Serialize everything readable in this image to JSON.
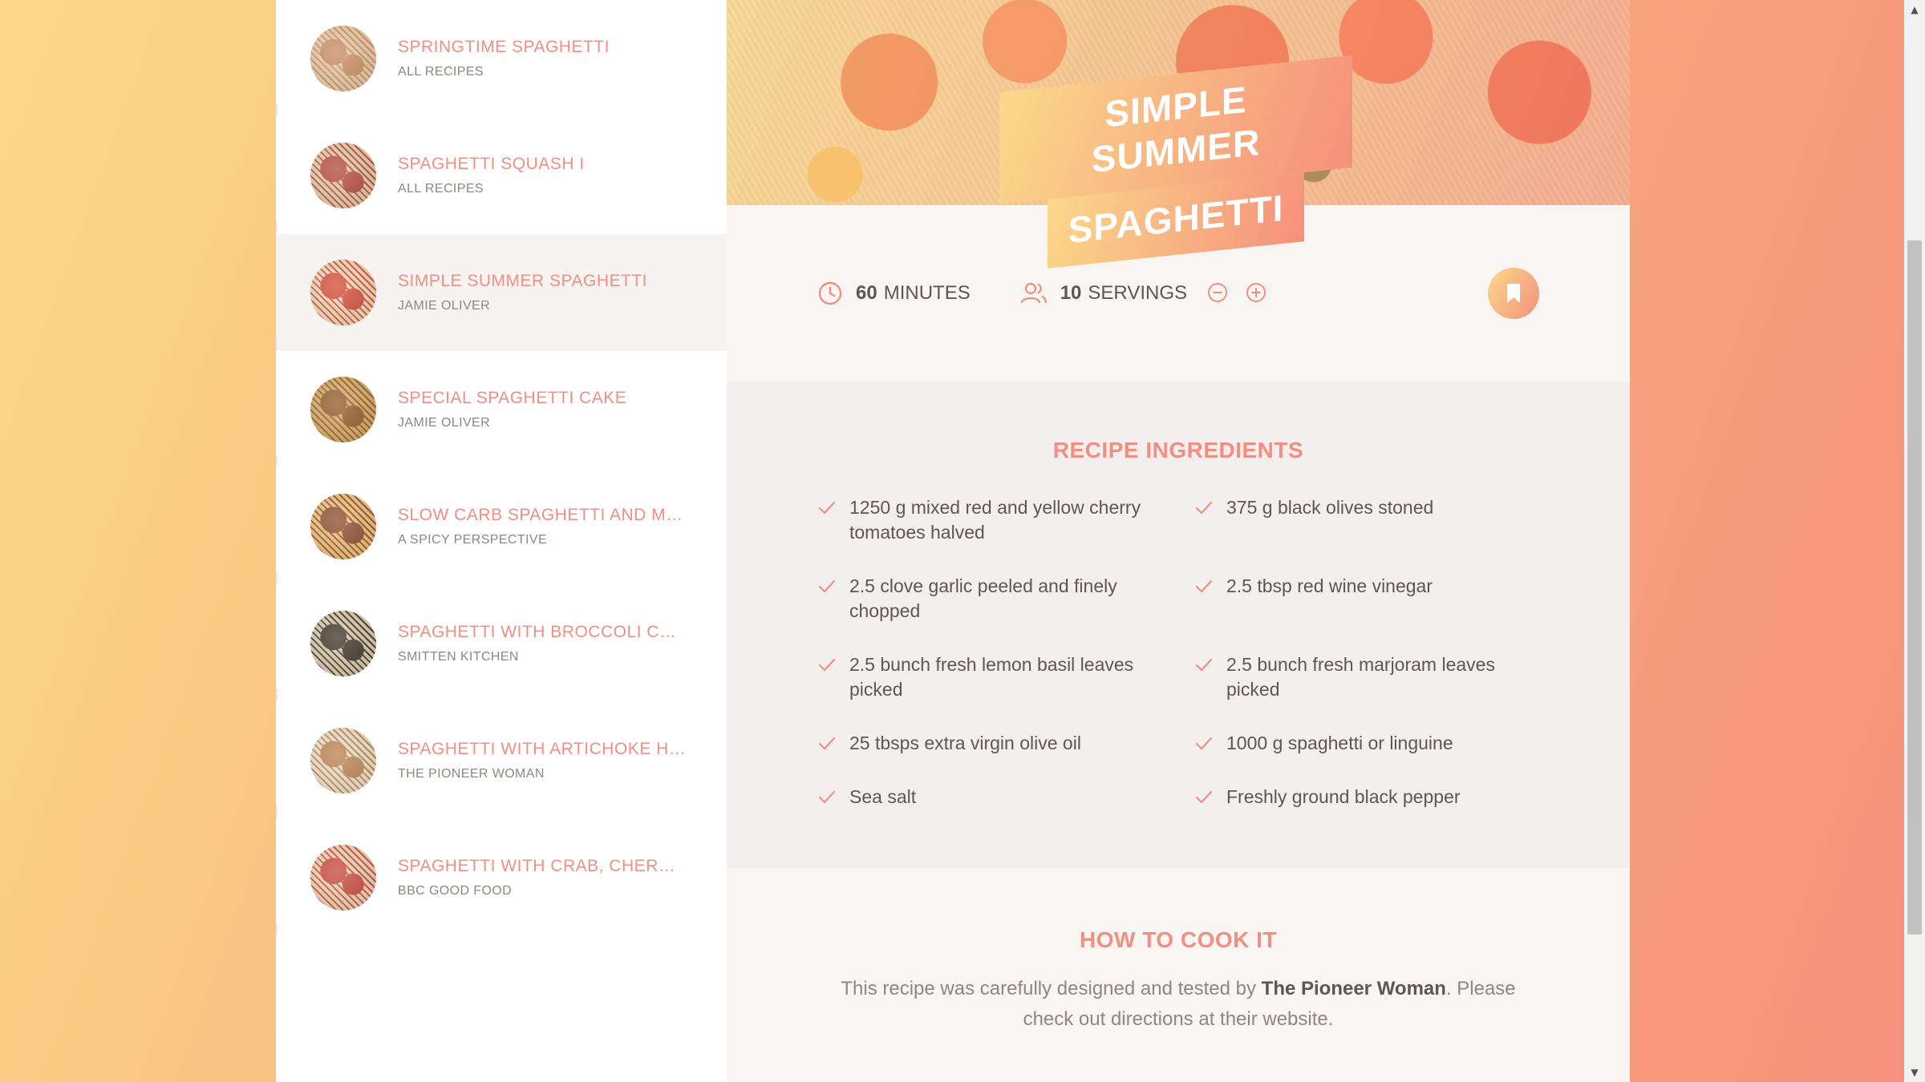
{
  "results": [
    {
      "title": "SPRINGTIME SPAGHETTI",
      "publisher": "ALL RECIPES",
      "colors": [
        "#c98a5e",
        "#e9c9a4"
      ],
      "active": false
    },
    {
      "title": "SPAGHETTI SQUASH I",
      "publisher": "ALL RECIPES",
      "colors": [
        "#b3473a",
        "#e3cba2"
      ],
      "active": false
    },
    {
      "title": "SIMPLE SUMMER SPAGHETTI",
      "publisher": "JAMIE OLIVER",
      "colors": [
        "#d24a35",
        "#f0d7b3"
      ],
      "active": true
    },
    {
      "title": "SPECIAL SPAGHETTI CAKE",
      "publisher": "JAMIE OLIVER",
      "colors": [
        "#8f5a26",
        "#d8a860"
      ],
      "active": false
    },
    {
      "title": "SLOW CARB SPAGHETTI AND ME...",
      "publisher": "A SPICY PERSPECTIVE",
      "colors": [
        "#8d4a2d",
        "#f0c070"
      ],
      "active": false
    },
    {
      "title": "SPAGHETTI WITH BROCCOLI CRE...",
      "publisher": "SMITTEN KITCHEN",
      "colors": [
        "#3d3224",
        "#d9c8a8"
      ],
      "active": false
    },
    {
      "title": "SPAGHETTI WITH ARTICHOKE HE...",
      "publisher": "THE PIONEER WOMAN",
      "colors": [
        "#b9824f",
        "#ece0c8"
      ],
      "active": false
    },
    {
      "title": "SPAGHETTI WITH CRAB, CHERRY ...",
      "publisher": "BBC GOOD FOOD",
      "colors": [
        "#c6463a",
        "#ecd3ae"
      ],
      "active": false
    }
  ],
  "recipe": {
    "title_line1": "SIMPLE SUMMER",
    "title_line2": "SPAGHETTI",
    "minutes": "60",
    "minutes_label": "MINUTES",
    "servings": "10",
    "servings_label": "SERVINGS"
  },
  "ingredients_heading": "RECIPE INGREDIENTS",
  "ingredients": [
    {
      "qty": "1250",
      "text": "g mixed red and yellow cherry tomatoes halved"
    },
    {
      "qty": "375",
      "text": "g black olives stoned"
    },
    {
      "qty": "2.5",
      "text": "clove garlic peeled and finely chopped"
    },
    {
      "qty": "2.5",
      "text": "tbsp red wine vinegar"
    },
    {
      "qty": "2.5",
      "text": "bunch fresh lemon basil leaves picked"
    },
    {
      "qty": "2.5",
      "text": "bunch fresh marjoram leaves picked"
    },
    {
      "qty": "25",
      "text": "tbsps extra virgin olive oil"
    },
    {
      "qty": "1000",
      "text": "g spaghetti or linguine"
    },
    {
      "qty": "",
      "text": "Sea salt"
    },
    {
      "qty": "",
      "text": "Freshly ground black pepper"
    }
  ],
  "cook": {
    "heading": "HOW TO COOK IT",
    "text_before": "This recipe was carefully designed and tested by",
    "publisher": "The Pioneer Woman",
    "text_after": ". Please check out directions at their website."
  },
  "colors": {
    "accent": "#f38e82",
    "gradient_start": "#fbd98a",
    "gradient_end": "#f5907c"
  },
  "icons": {
    "time": "clock-icon",
    "servings": "users-icon",
    "decrease": "minus-circle-icon",
    "increase": "plus-circle-icon",
    "bookmark": "bookmark-icon",
    "ingredient": "check-icon"
  }
}
